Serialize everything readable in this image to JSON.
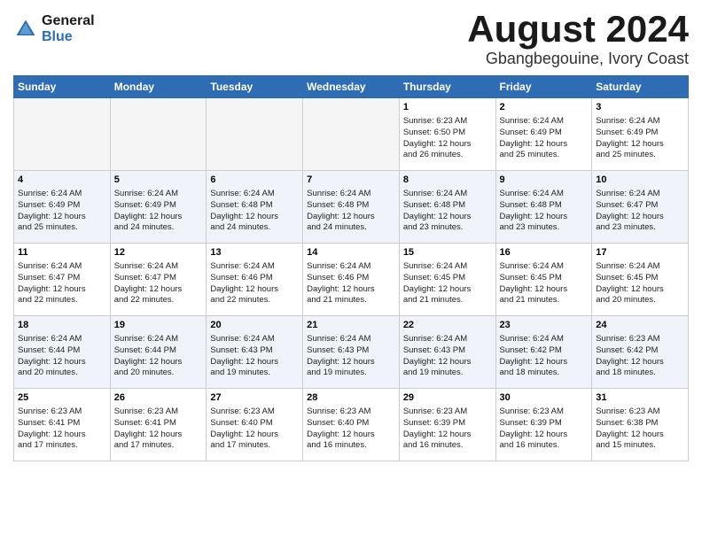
{
  "header": {
    "logo_line1": "General",
    "logo_line2": "Blue",
    "month_title": "August 2024",
    "location": "Gbangbegouine, Ivory Coast"
  },
  "days_of_week": [
    "Sunday",
    "Monday",
    "Tuesday",
    "Wednesday",
    "Thursday",
    "Friday",
    "Saturday"
  ],
  "weeks": [
    [
      {
        "num": "",
        "info": ""
      },
      {
        "num": "",
        "info": ""
      },
      {
        "num": "",
        "info": ""
      },
      {
        "num": "",
        "info": ""
      },
      {
        "num": "1",
        "info": "Sunrise: 6:23 AM\nSunset: 6:50 PM\nDaylight: 12 hours\nand 26 minutes."
      },
      {
        "num": "2",
        "info": "Sunrise: 6:24 AM\nSunset: 6:49 PM\nDaylight: 12 hours\nand 25 minutes."
      },
      {
        "num": "3",
        "info": "Sunrise: 6:24 AM\nSunset: 6:49 PM\nDaylight: 12 hours\nand 25 minutes."
      }
    ],
    [
      {
        "num": "4",
        "info": "Sunrise: 6:24 AM\nSunset: 6:49 PM\nDaylight: 12 hours\nand 25 minutes."
      },
      {
        "num": "5",
        "info": "Sunrise: 6:24 AM\nSunset: 6:49 PM\nDaylight: 12 hours\nand 24 minutes."
      },
      {
        "num": "6",
        "info": "Sunrise: 6:24 AM\nSunset: 6:48 PM\nDaylight: 12 hours\nand 24 minutes."
      },
      {
        "num": "7",
        "info": "Sunrise: 6:24 AM\nSunset: 6:48 PM\nDaylight: 12 hours\nand 24 minutes."
      },
      {
        "num": "8",
        "info": "Sunrise: 6:24 AM\nSunset: 6:48 PM\nDaylight: 12 hours\nand 23 minutes."
      },
      {
        "num": "9",
        "info": "Sunrise: 6:24 AM\nSunset: 6:48 PM\nDaylight: 12 hours\nand 23 minutes."
      },
      {
        "num": "10",
        "info": "Sunrise: 6:24 AM\nSunset: 6:47 PM\nDaylight: 12 hours\nand 23 minutes."
      }
    ],
    [
      {
        "num": "11",
        "info": "Sunrise: 6:24 AM\nSunset: 6:47 PM\nDaylight: 12 hours\nand 22 minutes."
      },
      {
        "num": "12",
        "info": "Sunrise: 6:24 AM\nSunset: 6:47 PM\nDaylight: 12 hours\nand 22 minutes."
      },
      {
        "num": "13",
        "info": "Sunrise: 6:24 AM\nSunset: 6:46 PM\nDaylight: 12 hours\nand 22 minutes."
      },
      {
        "num": "14",
        "info": "Sunrise: 6:24 AM\nSunset: 6:46 PM\nDaylight: 12 hours\nand 21 minutes."
      },
      {
        "num": "15",
        "info": "Sunrise: 6:24 AM\nSunset: 6:45 PM\nDaylight: 12 hours\nand 21 minutes."
      },
      {
        "num": "16",
        "info": "Sunrise: 6:24 AM\nSunset: 6:45 PM\nDaylight: 12 hours\nand 21 minutes."
      },
      {
        "num": "17",
        "info": "Sunrise: 6:24 AM\nSunset: 6:45 PM\nDaylight: 12 hours\nand 20 minutes."
      }
    ],
    [
      {
        "num": "18",
        "info": "Sunrise: 6:24 AM\nSunset: 6:44 PM\nDaylight: 12 hours\nand 20 minutes."
      },
      {
        "num": "19",
        "info": "Sunrise: 6:24 AM\nSunset: 6:44 PM\nDaylight: 12 hours\nand 20 minutes."
      },
      {
        "num": "20",
        "info": "Sunrise: 6:24 AM\nSunset: 6:43 PM\nDaylight: 12 hours\nand 19 minutes."
      },
      {
        "num": "21",
        "info": "Sunrise: 6:24 AM\nSunset: 6:43 PM\nDaylight: 12 hours\nand 19 minutes."
      },
      {
        "num": "22",
        "info": "Sunrise: 6:24 AM\nSunset: 6:43 PM\nDaylight: 12 hours\nand 19 minutes."
      },
      {
        "num": "23",
        "info": "Sunrise: 6:24 AM\nSunset: 6:42 PM\nDaylight: 12 hours\nand 18 minutes."
      },
      {
        "num": "24",
        "info": "Sunrise: 6:23 AM\nSunset: 6:42 PM\nDaylight: 12 hours\nand 18 minutes."
      }
    ],
    [
      {
        "num": "25",
        "info": "Sunrise: 6:23 AM\nSunset: 6:41 PM\nDaylight: 12 hours\nand 17 minutes."
      },
      {
        "num": "26",
        "info": "Sunrise: 6:23 AM\nSunset: 6:41 PM\nDaylight: 12 hours\nand 17 minutes."
      },
      {
        "num": "27",
        "info": "Sunrise: 6:23 AM\nSunset: 6:40 PM\nDaylight: 12 hours\nand 17 minutes."
      },
      {
        "num": "28",
        "info": "Sunrise: 6:23 AM\nSunset: 6:40 PM\nDaylight: 12 hours\nand 16 minutes."
      },
      {
        "num": "29",
        "info": "Sunrise: 6:23 AM\nSunset: 6:39 PM\nDaylight: 12 hours\nand 16 minutes."
      },
      {
        "num": "30",
        "info": "Sunrise: 6:23 AM\nSunset: 6:39 PM\nDaylight: 12 hours\nand 16 minutes."
      },
      {
        "num": "31",
        "info": "Sunrise: 6:23 AM\nSunset: 6:38 PM\nDaylight: 12 hours\nand 15 minutes."
      }
    ]
  ]
}
